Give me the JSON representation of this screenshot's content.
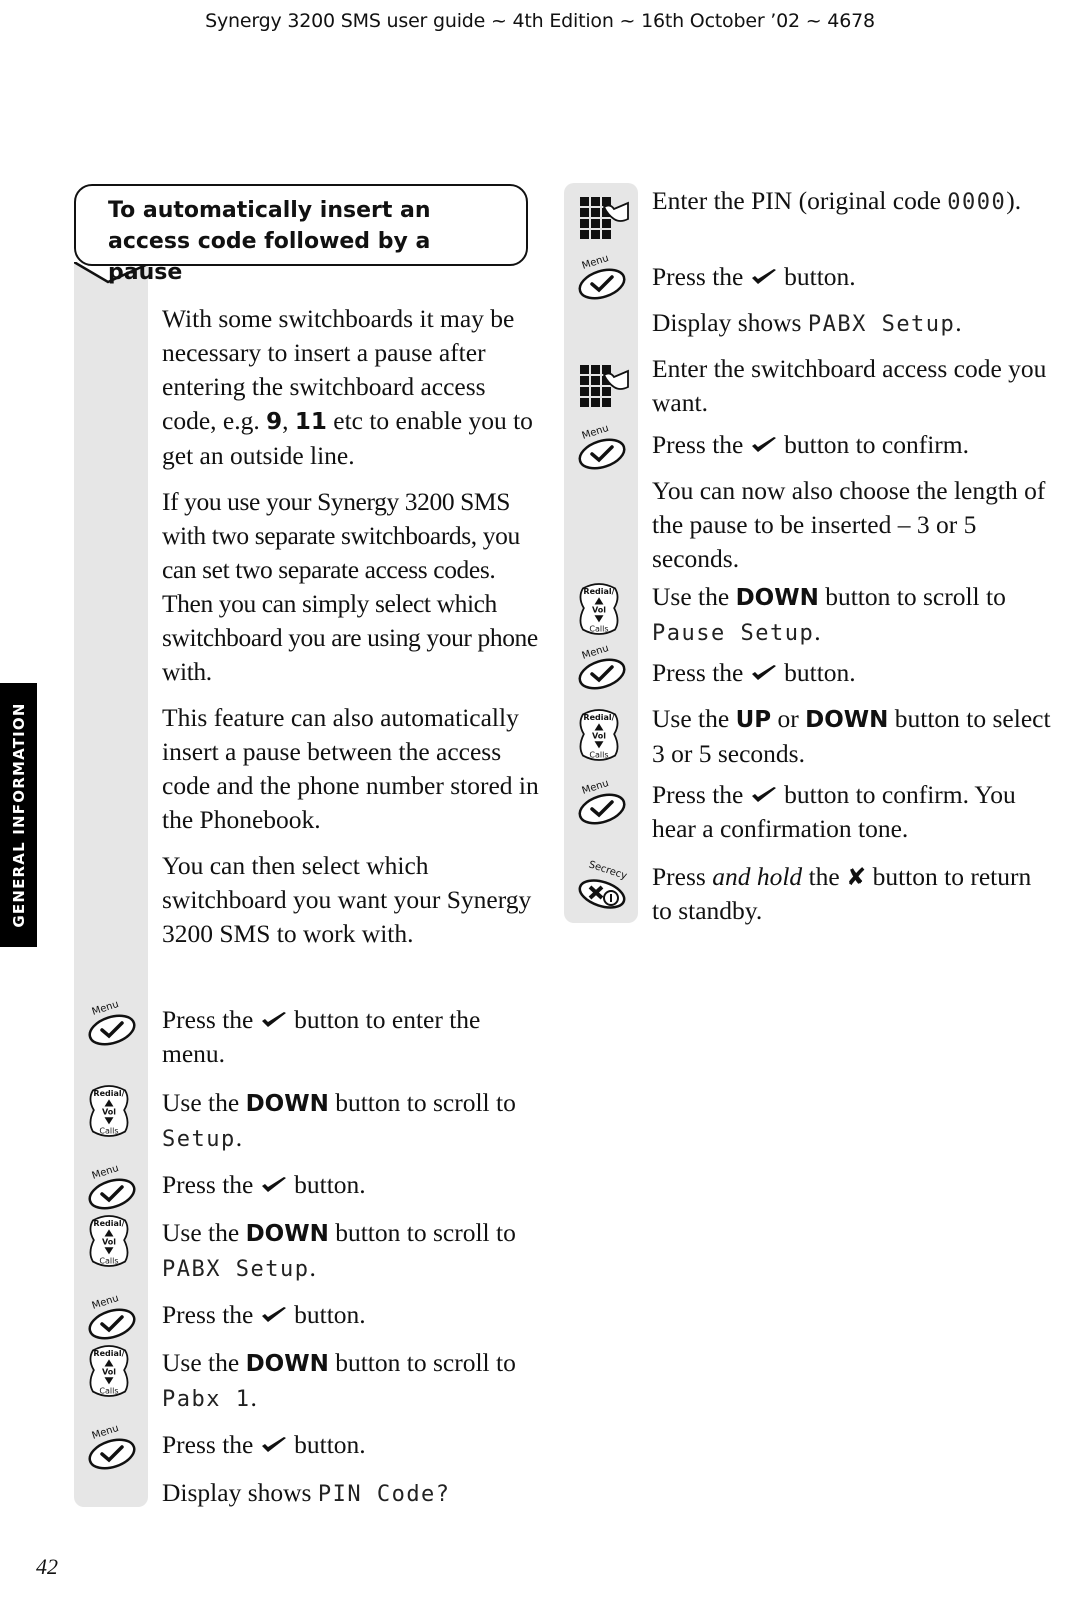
{
  "header": {
    "title": "Synergy 3200 SMS user guide ~ 4th Edition ~ 16th October ’02 ~ 4678"
  },
  "side_tab": {
    "label": "GENERAL INFORMATION"
  },
  "page_number": "42",
  "section": {
    "title": "To automatically insert an access code followed by a pause"
  },
  "icons": {
    "menu_label": "Menu",
    "redial_label": "Redial/",
    "vol_label": "Vol",
    "calls_label": "Calls",
    "secrecy_label": "Secrecy"
  },
  "intro": [
    {
      "pre": "With some switchboards it may be necessary to insert a pause after entering the switchboard access code, e.g. ",
      "b1": "9",
      "mid": ", ",
      "b2": "11",
      "post": " etc to enable you to get an outside line."
    },
    {
      "text": "If you use your Synergy 3200 SMS with two separate switchboards, you can set two separate access codes. Then you can simply select which switchboard you are using your phone with."
    },
    {
      "text": "This feature can also automatically insert a pause between the access code and the phone number stored in the Phonebook."
    },
    {
      "text": "You can then select which switchboard you want your Synergy 3200 SMS to work with."
    }
  ],
  "steps_left": [
    {
      "icon": "menu",
      "pre": "Press the ",
      "post": " button to enter the menu."
    },
    {
      "icon": "redial",
      "pre": "Use the ",
      "bold": "DOWN",
      "post": " button to scroll to ",
      "lcd": "Setup",
      "end": "."
    },
    {
      "icon": "menu",
      "pre": "Press the ",
      "post": " button."
    },
    {
      "icon": "redial",
      "pre": "Use the ",
      "bold": "DOWN",
      "post": " button to scroll to ",
      "lcd": "PABX Setup",
      "end": "."
    },
    {
      "icon": "menu",
      "pre": "Press the ",
      "post": " button."
    },
    {
      "icon": "redial",
      "pre": "Use the ",
      "bold": "DOWN",
      "post": " button to scroll to ",
      "lcd": "Pabx 1",
      "end": "."
    },
    {
      "icon": "menu",
      "pre": "Press the ",
      "post": " button."
    },
    {
      "icon": "none",
      "pre": "Display shows ",
      "lcd": "PIN Code?"
    }
  ],
  "steps_right": [
    {
      "icon": "keypad",
      "pre": "Enter the PIN (original code ",
      "lcd": "0000",
      "end": ")."
    },
    {
      "icon": "menu",
      "pre": "Press the ",
      "post": " button."
    },
    {
      "icon": "none",
      "pre": "Display shows ",
      "lcd": "PABX Setup",
      "end": "."
    },
    {
      "icon": "keypad",
      "pre": "Enter the switchboard access code you want."
    },
    {
      "icon": "menu",
      "pre": "Press the ",
      "post": " button to confirm."
    },
    {
      "icon": "none",
      "pre": "You can now also choose the length of the pause to be inserted – 3 or 5 seconds."
    },
    {
      "icon": "redial",
      "pre": "Use the ",
      "bold": "DOWN",
      "post": " button to scroll to ",
      "lcd": "Pause Setup",
      "end": "."
    },
    {
      "icon": "menu",
      "pre": "Press the ",
      "post": " button."
    },
    {
      "icon": "redial",
      "pre": "Use the ",
      "bold": "UP",
      "mid": " or ",
      "bold2": "DOWN",
      "post": " button to select 3 or 5 seconds."
    },
    {
      "icon": "menu",
      "pre": "Press the ",
      "post": " button to confirm. You hear a confirmation tone."
    },
    {
      "icon": "secrecy",
      "pre": "Press ",
      "italic": "and hold",
      "mid": " the ",
      "xmark": "✘",
      "post": " button to return to standby."
    }
  ]
}
